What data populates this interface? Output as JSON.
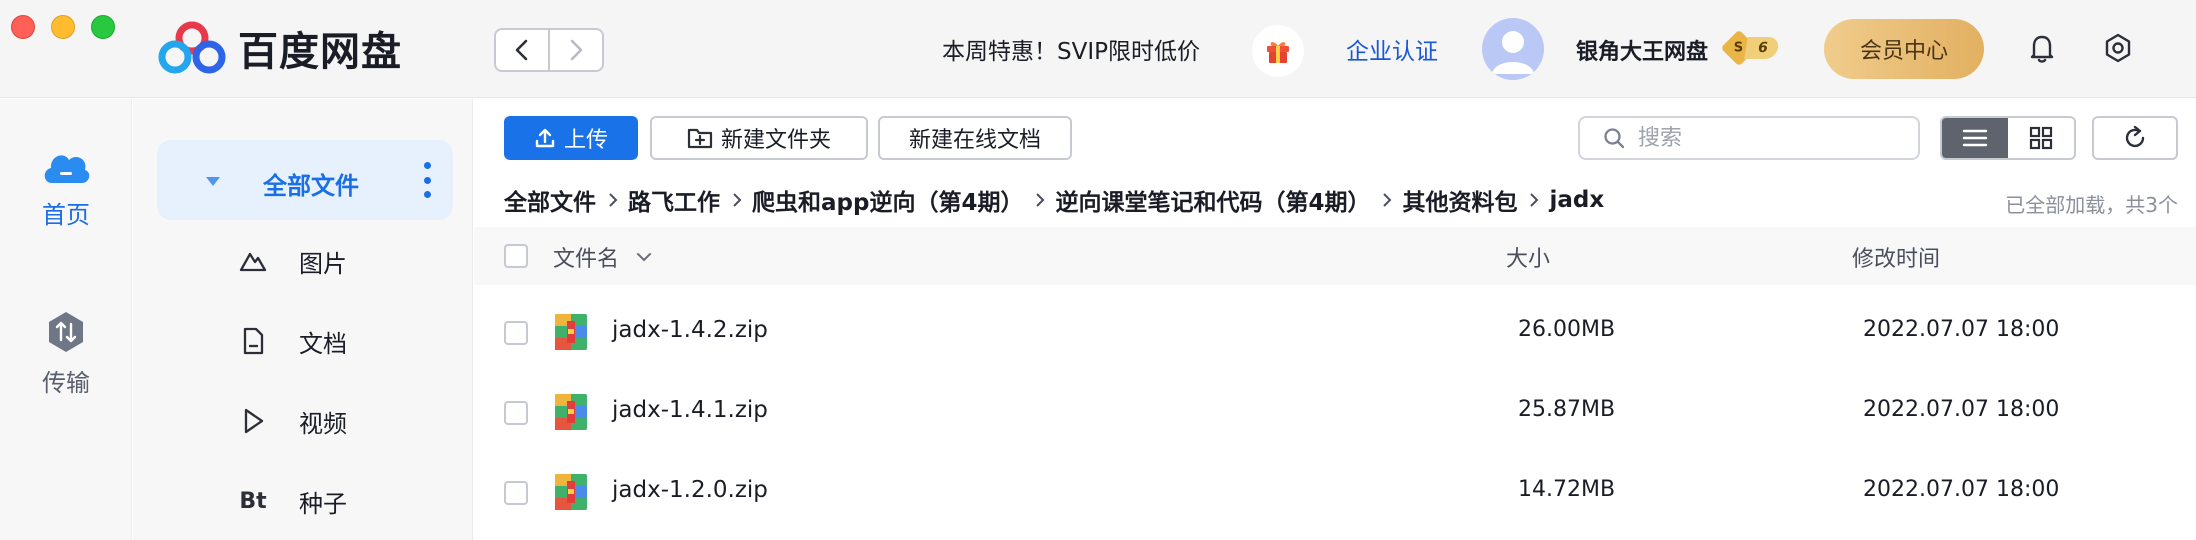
{
  "app": {
    "brand_name": "百度网盘",
    "promo_text": "本周特惠！SVIP限时低价",
    "enterprise_link": "企业认证",
    "username": "银角大王网盘",
    "vip_tier": "S",
    "vip_level": "6",
    "member_center": "会员中心"
  },
  "rail": {
    "home_label": "首页",
    "transfer_label": "传输"
  },
  "sidebar": {
    "active_label": "全部文件",
    "items": [
      {
        "label": "图片",
        "icon": "image-icon"
      },
      {
        "label": "文档",
        "icon": "document-icon"
      },
      {
        "label": "视频",
        "icon": "video-icon"
      },
      {
        "label": "种子",
        "icon": "bt-icon",
        "icon_text": "Bt"
      }
    ]
  },
  "toolbar": {
    "upload_label": "上传",
    "new_folder_label": "新建文件夹",
    "new_doc_label": "新建在线文档",
    "search_placeholder": "搜索"
  },
  "breadcrumb": [
    "全部文件",
    "路飞工作",
    "爬虫和app逆向（第4期）",
    "逆向课堂笔记和代码（第4期）",
    "其他资料包",
    "jadx"
  ],
  "load_status": "已全部加载，共3个",
  "table": {
    "col_name": "文件名",
    "col_size": "大小",
    "col_time": "修改时间",
    "rows": [
      {
        "name": "jadx-1.4.2.zip",
        "size": "26.00MB",
        "time": "2022.07.07 18:00"
      },
      {
        "name": "jadx-1.4.1.zip",
        "size": "25.87MB",
        "time": "2022.07.07 18:00"
      },
      {
        "name": "jadx-1.2.0.zip",
        "size": "14.72MB",
        "time": "2022.07.07 18:00"
      }
    ]
  },
  "colors": {
    "accent": "#1a72e8",
    "active_bg": "#e6f1fd",
    "member_gold": "#e2b061"
  }
}
